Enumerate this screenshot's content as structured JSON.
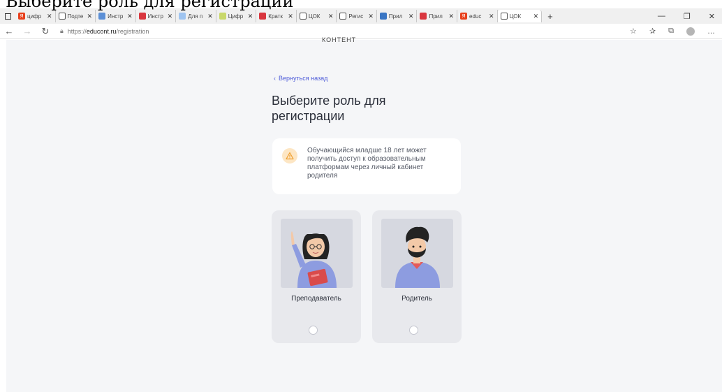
{
  "overlay_title": "Выберите роль для регистрации",
  "browser": {
    "tabs": [
      {
        "label": "цифр",
        "color": "#e8401c",
        "glyph": "Я"
      },
      {
        "label": "Подте",
        "color": "#ffffff",
        "glyph": ""
      },
      {
        "label": "Инстр",
        "color": "#5b8fd6",
        "glyph": ""
      },
      {
        "label": "Инстр",
        "color": "#d9363e",
        "glyph": ""
      },
      {
        "label": "Для п",
        "color": "#9fc4f0",
        "glyph": ""
      },
      {
        "label": "Цифр",
        "color": "#c9d86a",
        "glyph": ""
      },
      {
        "label": "Кратк",
        "color": "#d9363e",
        "glyph": ""
      },
      {
        "label": "ЦОК",
        "color": "#ffffff",
        "glyph": ""
      },
      {
        "label": "Регис",
        "color": "#ffffff",
        "glyph": ""
      },
      {
        "label": "Прил",
        "color": "#3a76c4",
        "glyph": ""
      },
      {
        "label": "Прил",
        "color": "#d9363e",
        "glyph": ""
      },
      {
        "label": "educ",
        "color": "#e8401c",
        "glyph": "Я"
      }
    ],
    "active_tab": "ЦОК",
    "url_prefix": "https://",
    "url_host": "educont.ru",
    "url_path": "/registration"
  },
  "page": {
    "logo_partial": "КОНТЕНТ",
    "back_link": "Вернуться назад",
    "title": "Выберите роль для регистрации",
    "notice": "Обучающийся младше 18 лет может получить доступ к образовательным платформам через личный кабинет родителя",
    "roles": [
      {
        "label": "Преподаватель",
        "selected": false
      },
      {
        "label": "Родитель",
        "selected": false
      }
    ]
  },
  "colors": {
    "accent": "#4f5dd9",
    "page_bg": "#f5f6f8",
    "card_bg": "#e8e9ed",
    "warning": "#f0a030"
  }
}
